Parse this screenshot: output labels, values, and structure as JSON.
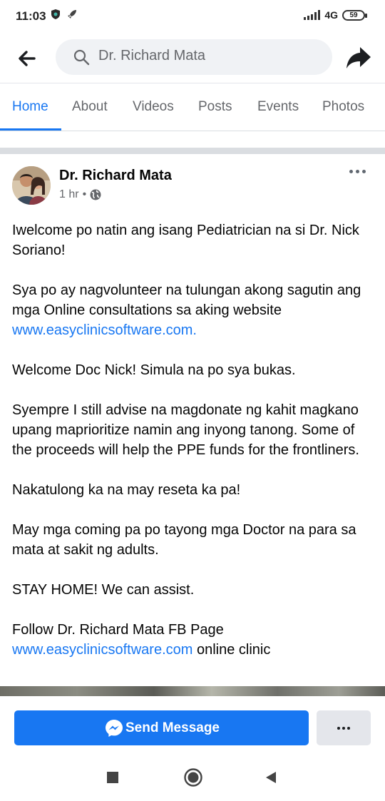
{
  "status_bar": {
    "time": "11:03",
    "network": "4G",
    "battery": "59"
  },
  "search": {
    "query": "Dr. Richard Mata"
  },
  "tabs": [
    {
      "label": "Home",
      "active": true
    },
    {
      "label": "About",
      "active": false
    },
    {
      "label": "Videos",
      "active": false
    },
    {
      "label": "Posts",
      "active": false
    },
    {
      "label": "Events",
      "active": false
    },
    {
      "label": "Photos",
      "active": false
    }
  ],
  "post": {
    "author": "Dr. Richard Mata",
    "time": "1 hr",
    "separator": "•",
    "p1": "Iwelcome po natin ang isang Pediatrician na si Dr. Nick Soriano!",
    "p2_text": "Sya po ay nagvolunteer na tulungan akong sagutin ang mga Online consultations sa aking website",
    "p2_link": "www.easyclinicsoftware.com.",
    "p3": "Welcome Doc Nick! Simula na po sya bukas.",
    "p4": "Syempre I still advise na magdonate ng kahit magkano upang maprioritize namin ang inyong tanong. Some of the proceeds will help the PPE funds for the frontliners.",
    "p5": "Nakatulong ka na may reseta ka pa!",
    "p6": "May mga coming pa po tayong mga Doctor na para sa mata at sakit ng adults.",
    "p7": "STAY HOME! We can assist.",
    "p8_text": "Follow Dr. Richard Mata FB Page",
    "p8_link": "www.easyclinicsoftware.com",
    "p8_suffix": "online clinic"
  },
  "cta": {
    "send_label": "Send Message"
  },
  "colors": {
    "accent": "#1877f2",
    "text": "#050505",
    "muted": "#65676b"
  }
}
